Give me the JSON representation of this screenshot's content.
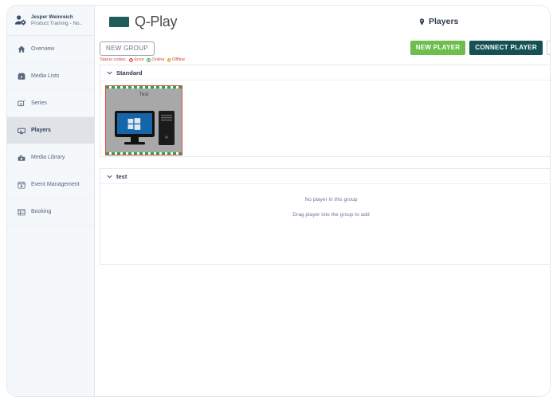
{
  "sidebar": {
    "profile": {
      "name": "Jesper Weinreich",
      "org": "Product Training - No..",
      "icon": "user-gear-icon"
    },
    "items": [
      {
        "label": "Overview",
        "icon": "home-icon",
        "active": false
      },
      {
        "label": "Media Lists",
        "icon": "media-box-icon",
        "active": false
      },
      {
        "label": "Series",
        "icon": "series-icon",
        "active": false
      },
      {
        "label": "Players",
        "icon": "player-icon",
        "active": true
      },
      {
        "label": "Media Library",
        "icon": "library-icon",
        "active": false
      },
      {
        "label": "Event Management",
        "icon": "calendar-event-icon",
        "active": false
      },
      {
        "label": "Booking",
        "icon": "booking-icon",
        "active": false
      }
    ]
  },
  "header": {
    "logo_text": "Q-Play",
    "logo_color": "#1f5c5c",
    "page_title": "Players",
    "page_title_icon": "location-pin-icon"
  },
  "toolbar": {
    "new_group_label": "NEW GROUP",
    "new_player_label": "NEW PLAYER",
    "connect_player_label": "CONNECT PLAYER",
    "grid_view_icon": "grid-view-icon",
    "new_player_color": "#6cbe4d",
    "connect_player_color": "#155153",
    "status_codes": {
      "label": "Status codes:",
      "items": [
        {
          "label": "Error",
          "color": "#e03b30"
        },
        {
          "label": "Online",
          "color": "#35a14a"
        },
        {
          "label": "Offline",
          "color": "#eda227"
        }
      ]
    }
  },
  "groups": [
    {
      "name": "Standard",
      "collapse_icon": "chevron-down-icon",
      "players": [
        {
          "name": "Test",
          "status": "online",
          "status_border_color": "#e04a3c",
          "selection_color": "#2fa24a",
          "thumbnail_icon": "windows-desktop-icon"
        }
      ]
    },
    {
      "name": "test",
      "collapse_icon": "chevron-down-icon",
      "players": [],
      "empty_message": "No player in this group",
      "empty_hint": "Drag player into the group to add"
    }
  ]
}
